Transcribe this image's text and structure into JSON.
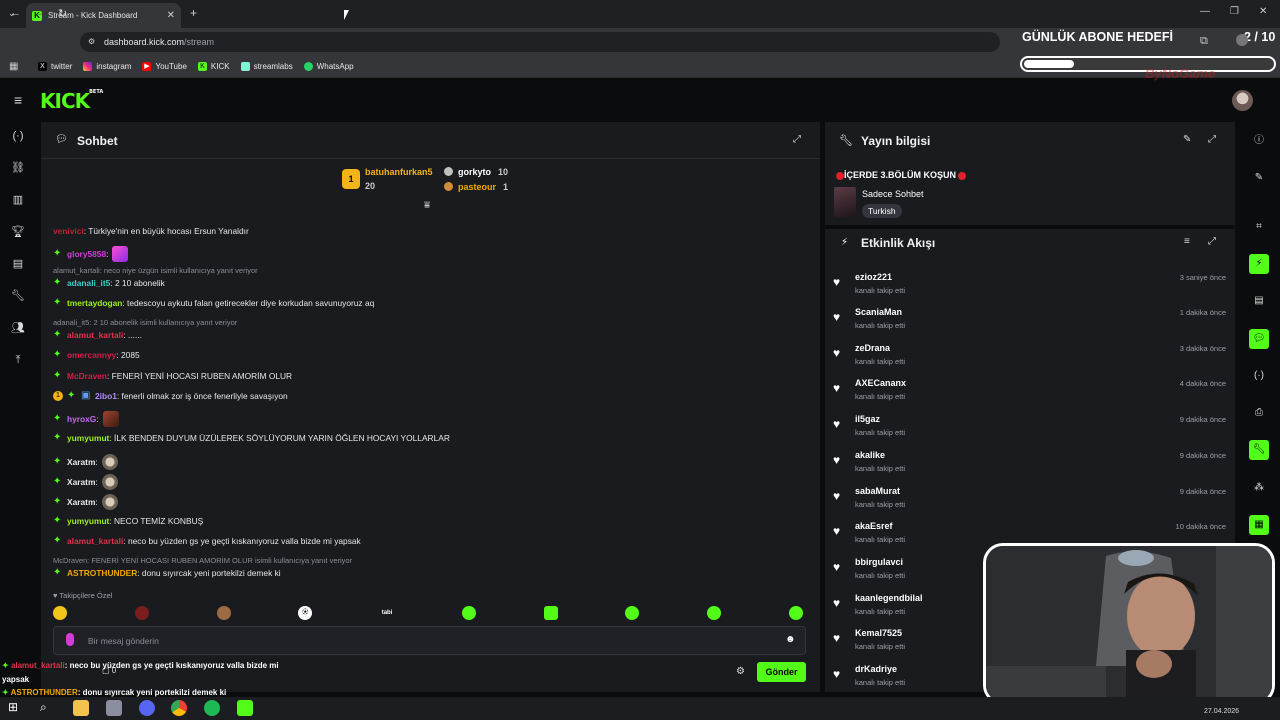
{
  "browser": {
    "tab_title": "Stream - Kick Dashboard",
    "url_domain": "dashboard.kick.com",
    "url_path": "/stream",
    "bookmarks": [
      "twitter",
      "instagram",
      "YouTube",
      "KICK",
      "streamlabs",
      "WhatsApp"
    ]
  },
  "header": {
    "logo": "KICK",
    "logo_badge": "BETA"
  },
  "overlay": {
    "abone_title": "GÜNLÜK ABONE HEDEFİ",
    "abone_count": "2 / 10",
    "abone_progress": 0.2,
    "watermark": "ByNoGame"
  },
  "chat": {
    "title": "Sohbet",
    "leaderboard": {
      "first": {
        "rank": "1",
        "name": "batuhanfurkan5",
        "value": "20"
      },
      "second": {
        "name": "gorkyto",
        "value": "10"
      },
      "third": {
        "name": "pasteour",
        "value": "1"
      }
    },
    "messages": [
      {
        "user": "venivici",
        "text": ": Türkiye'nin en büyük hocası Ersun Yanaldır",
        "color": "#b3262c"
      },
      {
        "user": "glory5858",
        "text": ":",
        "color": "#d83ad8"
      },
      {
        "reply": "alamut_kartali: neco niye üzgün isimli kullanıcıya yanıt veriyor"
      },
      {
        "user": "adanali_it5",
        "text": ": 2 10 abonelik",
        "color": "#3ad1c4"
      },
      {
        "user": "tmertaydogan",
        "text": ": tedescoyu aykutu falan getirecekler diye korkudan savunuyoruz aq",
        "color": "#9ef01a"
      },
      {
        "reply": "adanali_it5: 2 10 abonelik isimli kullanıcıya yanıt veriyor"
      },
      {
        "user": "alamut_kartali",
        "text": ": ......",
        "color": "#e0324a"
      },
      {
        "user": "omercannyy",
        "text": ": 2085",
        "color": "#d31f47"
      },
      {
        "user": "McDraven",
        "text": ": FENERİ YENİ HOCASI RUBEN AMORİM OLUR",
        "color": "#d31f47"
      },
      {
        "user": "2ibo1",
        "text": ": fenerli olmak zor iş önce fenerliyle savaşıyon",
        "color": "#b28cff"
      },
      {
        "user": "hyroxG",
        "text": ":",
        "color": "#c56cf0"
      },
      {
        "user": "yumyumut",
        "text": ": İLK BENDEN DUYUM ÜZÜLEREK SÖYLÜYORUM YARIN ÖĞLEN HOCAYI YOLLARLAR",
        "color": "#9ef01a"
      },
      {
        "user": "Xaratm",
        "text": ":",
        "color": "#e8e8e8"
      },
      {
        "user": "Xaratm",
        "text": ":",
        "color": "#e8e8e8"
      },
      {
        "user": "Xaratm",
        "text": ":",
        "color": "#e8e8e8"
      },
      {
        "user": "yumyumut",
        "text": ": NECO TEMİZ KONBUŞ",
        "color": "#9ef01a"
      },
      {
        "user": "alamut_kartali",
        "text": ": neco bu yüzden gs ye geçti kıskanıyoruz valla bizde mi yapsak",
        "color": "#e0324a"
      },
      {
        "reply": "McDraven: FENERİ YENİ HOCASI RUBEN AMORİM OLUR isimli kullanıcıya yanıt veriyor"
      },
      {
        "user": "ASTROTHUNDER",
        "text": ": donu sıyırcak yeni portekilzi demek ki",
        "color": "#f2a900"
      }
    ],
    "followers_special": "Takipçilere Özel",
    "input_placeholder": "Bir mesaj gönderin",
    "send_label": "Gönder",
    "counters": {
      "viewers": "0"
    }
  },
  "stream_info": {
    "title": "Yayın bilgisi",
    "stream_title": "İÇERDE 3.BÖLÜM KOŞUN",
    "category": "Sadece Sohbet",
    "language": "Turkish"
  },
  "activity": {
    "title": "Etkinlik Akışı",
    "items": [
      {
        "name": "ezioz221",
        "action": "kanalı takip etti",
        "time": "3 saniye önce"
      },
      {
        "name": "ScaniaMan",
        "action": "kanalı takip etti",
        "time": "1 dakika önce"
      },
      {
        "name": "zeDrana",
        "action": "kanalı takip etti",
        "time": "3 dakika önce"
      },
      {
        "name": "AXECananx",
        "action": "kanalı takip etti",
        "time": "4 dakika önce"
      },
      {
        "name": "il5gaz",
        "action": "kanalı takip etti",
        "time": "9 dakika önce"
      },
      {
        "name": "akalike",
        "action": "kanalı takip etti",
        "time": "9 dakika önce"
      },
      {
        "name": "sabaMurat",
        "action": "kanalı takip etti",
        "time": "9 dakika önce"
      },
      {
        "name": "akaEsref",
        "action": "kanalı takip etti",
        "time": "10 dakika önce"
      },
      {
        "name": "bbirgulavci",
        "action": "kanalı takip etti",
        "time": ""
      },
      {
        "name": "kaanlegendbilal",
        "action": "kanalı takip etti",
        "time": ""
      },
      {
        "name": "Kemal7525",
        "action": "kanalı takip etti",
        "time": ""
      },
      {
        "name": "drKadriye",
        "action": "kanalı takip etti",
        "time": ""
      }
    ]
  },
  "bottom_overlay": {
    "line1_user": "alamut_kartali",
    "line1_text": ": neco bu yüzden gs ye geçti kıskanıyoruz valla bizde mi",
    "line1_cont": "yapsak",
    "line2_user": "ASTROTHUNDER",
    "line2_text": ": donu sıyırcak yeni portekilzi demek ki"
  },
  "taskbar": {
    "date": "27.04.2026"
  }
}
